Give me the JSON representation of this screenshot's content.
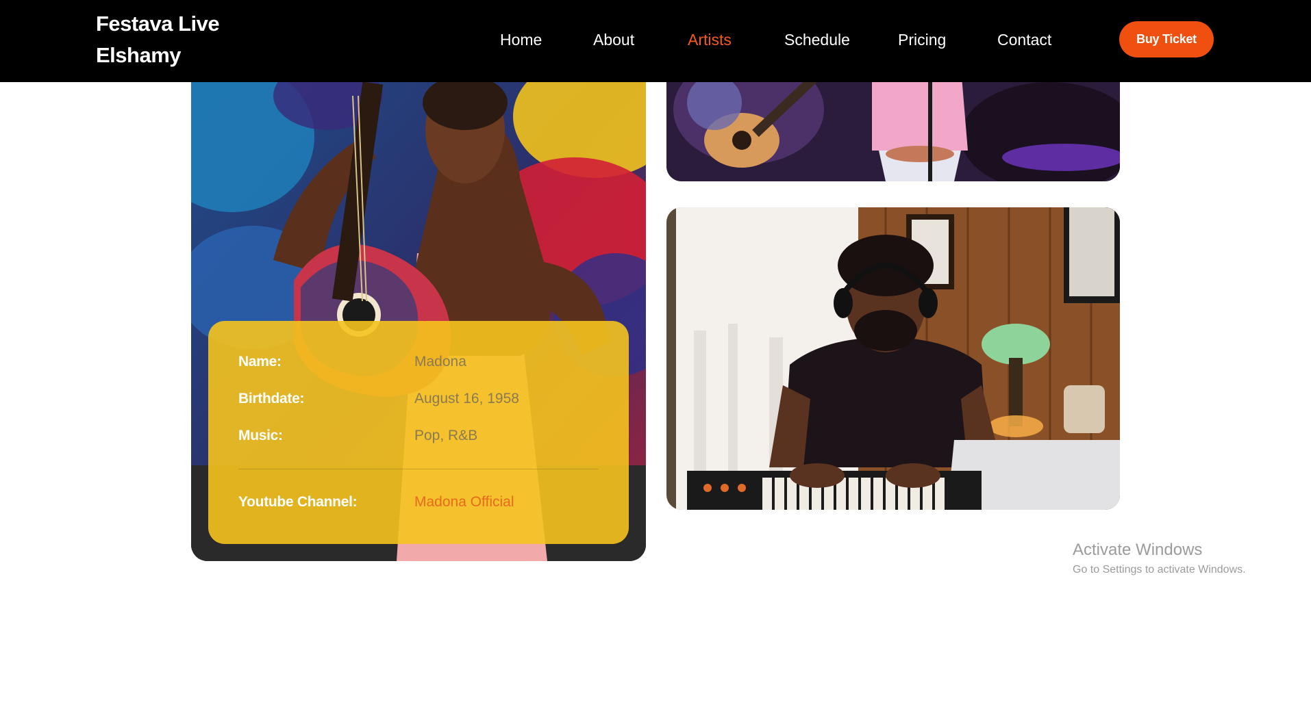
{
  "brand": {
    "line1": "Festava Live",
    "line2": "Elshamy"
  },
  "nav": {
    "home": "Home",
    "about": "About",
    "artists": "Artists",
    "schedule": "Schedule",
    "pricing": "Pricing",
    "contact": "Contact",
    "active": "Artists"
  },
  "cta": {
    "label": "Buy Ticket"
  },
  "artist": {
    "name_label": "Name:",
    "name_value": "Madona",
    "birth_label": "Birthdate:",
    "birth_value": "August 16, 1958",
    "music_label": "Music:",
    "music_value": "Pop, R&B",
    "youtube_label": "Youtube Channel:",
    "youtube_value": "Madona Official"
  },
  "watermark": {
    "title": "Activate Windows",
    "subtitle": "Go to Settings to activate Windows."
  },
  "colors": {
    "accent": "#f0500f",
    "navbar_bg": "#000000",
    "info_card": "#f5c31e"
  }
}
